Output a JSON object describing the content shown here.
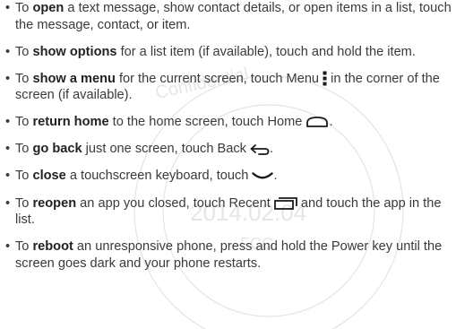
{
  "watermark": {
    "year_text": "2014.02.04",
    "confidential_text": "Confidential",
    "code_text": "FCC"
  },
  "items": [
    {
      "pre": "To ",
      "keyword": "open",
      "mid": " a text message, show contact details, or open items in a list, touch the message, contact, or item.",
      "icon": "",
      "post": ""
    },
    {
      "pre": "To ",
      "keyword": "show options",
      "mid": " for a list item (if available), touch and hold the item.",
      "icon": "",
      "post": ""
    },
    {
      "pre": "To ",
      "keyword": "show a menu",
      "mid": " for the current screen, touch Menu ",
      "icon": "menu-dots-icon",
      "post": " in the corner of the screen (if available)."
    },
    {
      "pre": "To ",
      "keyword": "return home",
      "mid": " to the home screen, touch Home ",
      "icon": "home-icon",
      "post": "."
    },
    {
      "pre": "To ",
      "keyword": "go back",
      "mid": " just one screen, touch Back ",
      "icon": "back-icon",
      "post": "."
    },
    {
      "pre": "To ",
      "keyword": "close",
      "mid": " a touchscreen keyboard, touch ",
      "icon": "keyboard-close-icon",
      "post": "."
    },
    {
      "pre": "To ",
      "keyword": "reopen",
      "mid": " an app you closed, touch Recent ",
      "icon": "recent-apps-icon",
      "post": " and touch the app in the list."
    },
    {
      "pre": "To ",
      "keyword": "reboot",
      "mid": " an unresponsive phone, press and hold the Power key until the screen goes dark and your phone restarts.",
      "icon": "",
      "post": ""
    }
  ],
  "bullet_char": "•"
}
